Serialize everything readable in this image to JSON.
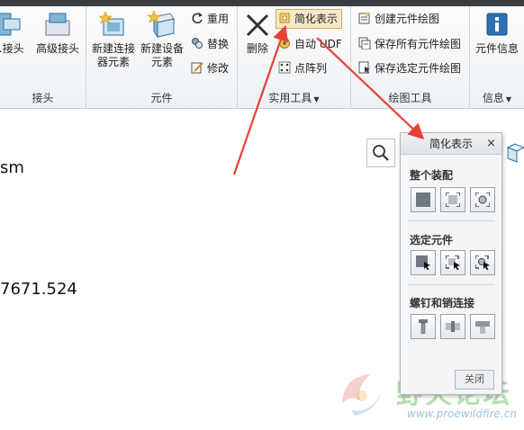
{
  "ribbon": {
    "connectors_group": {
      "label": "接头",
      "buttons": [
        "...接头",
        "高级接头"
      ]
    },
    "components_group": {
      "label": "元件",
      "new_connector": "新建连接器元素",
      "new_device": "新建设备元素",
      "reuse": "重用",
      "replace": "替换",
      "modify": "修改"
    },
    "utilities_group": {
      "label": "实用工具",
      "delete": "删除",
      "simplified_rep": "简化表示",
      "auto_udf": "自动 UDF",
      "point_pattern": "点阵列"
    },
    "drawing_group": {
      "label": "绘图工具",
      "create_component_drawing": "创建元件绘图",
      "save_all_drawings": "保存所有元件绘图",
      "save_selected_drawings": "保存选定元件绘图"
    },
    "info_group": {
      "label": "信息",
      "component_info": "元件信息"
    }
  },
  "workarea": {
    "text_line1": "sm",
    "text_line2": "7671.524"
  },
  "panel": {
    "title": "简化表示",
    "close_glyph": "×",
    "sections": [
      {
        "title": "整个装配"
      },
      {
        "title": "选定元件"
      },
      {
        "title": "螺钉和销连接"
      }
    ],
    "close_button": "关闭"
  },
  "watermark": {
    "main": "野火论坛",
    "sub": "www.proewildfire.cn"
  },
  "colors": {
    "arrow": "#e8403a",
    "highlight_bg": "#f4e9c9",
    "highlight_border": "#d2a94e"
  }
}
